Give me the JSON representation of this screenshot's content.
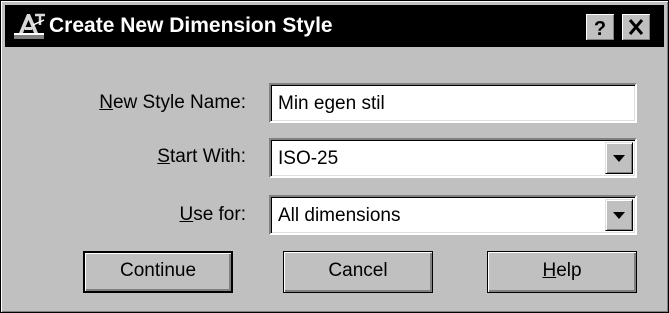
{
  "window": {
    "title": "Create New Dimension Style",
    "app_icon": "autocad-icon",
    "help_button_glyph": "?",
    "close_button_glyph": "X"
  },
  "form": {
    "new_style_name": {
      "label_mnemonic": "N",
      "label_rest": "ew Style Name:",
      "value": "Min egen stil"
    },
    "start_with": {
      "label_mnemonic": "S",
      "label_rest": "tart With:",
      "value": "ISO-25",
      "icon": "chevron-down-icon"
    },
    "use_for": {
      "label_mnemonic": "U",
      "label_rest": "se for:",
      "value": "All dimensions",
      "icon": "chevron-down-icon"
    }
  },
  "buttons": {
    "continue_label": "Continue",
    "cancel_label": "Cancel",
    "help_mnemonic": "H",
    "help_rest": "elp"
  },
  "colors": {
    "dialog_face": "#c0c0c0",
    "titlebar": "#000000",
    "title_text": "#ffffff",
    "field_bg": "#ffffff"
  }
}
